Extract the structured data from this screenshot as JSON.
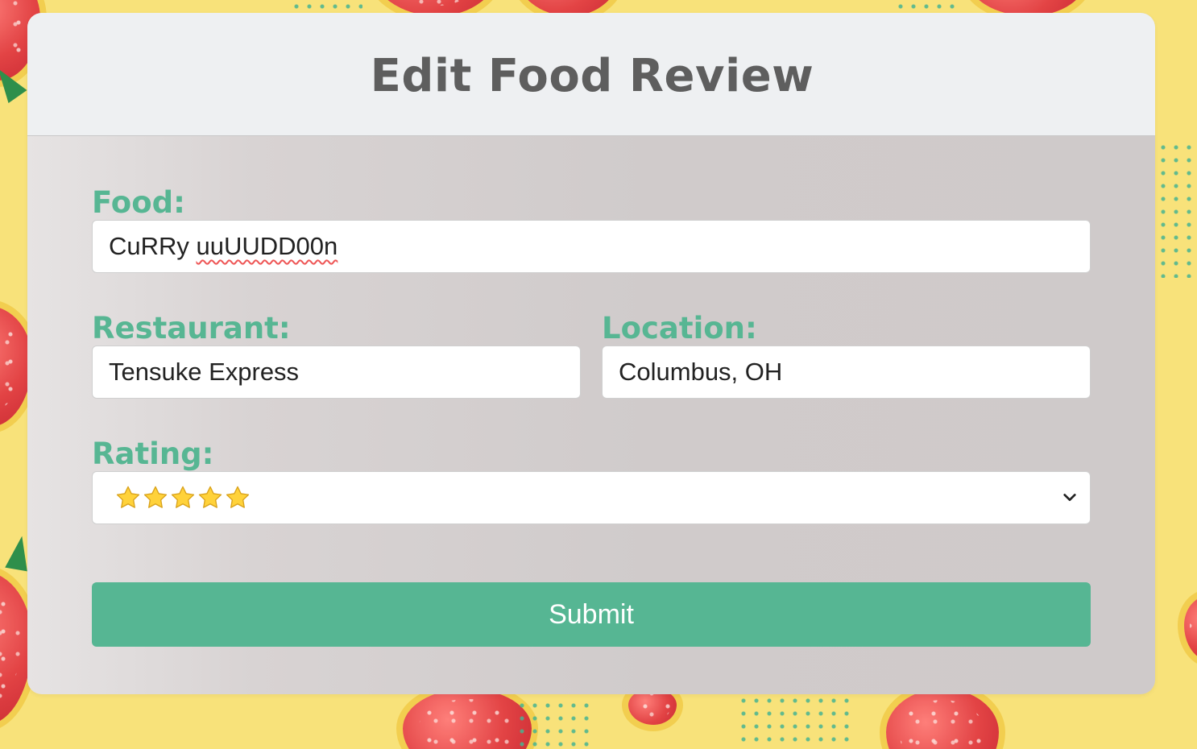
{
  "page": {
    "title": "Edit Food Review"
  },
  "form": {
    "food": {
      "label": "Food:",
      "value_plain": "CuRRy ",
      "value_misspelled": "uuUUDD00n"
    },
    "restaurant": {
      "label": "Restaurant:",
      "value": "Tensuke Express"
    },
    "location": {
      "label": "Location:",
      "value": "Columbus, OH"
    },
    "rating": {
      "label": "Rating:",
      "selected_stars": 5,
      "selected_display": "⭐⭐⭐⭐⭐"
    },
    "submit_label": "Submit"
  },
  "colors": {
    "accent": "#56b693",
    "title": "#5e5e5e",
    "background": "#f8e27a"
  }
}
